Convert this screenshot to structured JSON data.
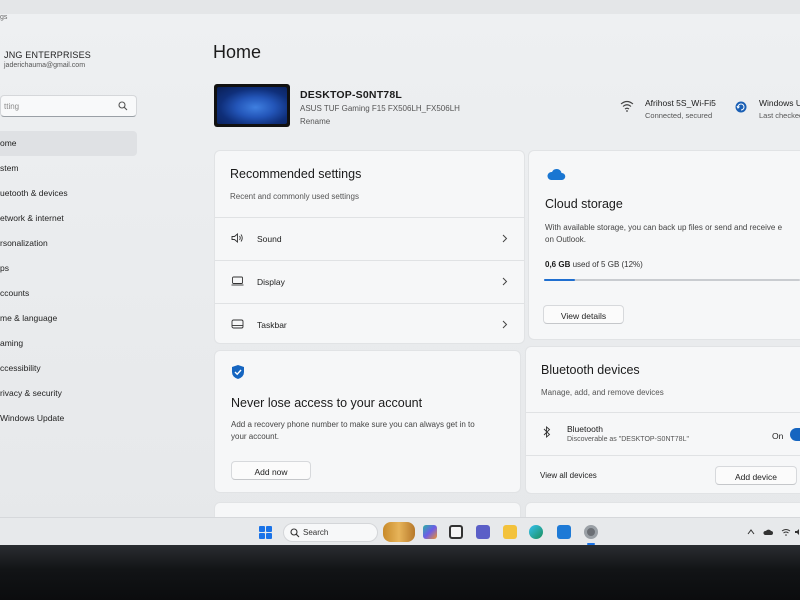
{
  "app": {
    "title": "gs"
  },
  "account": {
    "name": "JNG ENTERPRISES",
    "email": "jaderichauma@gmail.com"
  },
  "sidebar": {
    "search_placeholder": "tting",
    "items": [
      {
        "label": "ome"
      },
      {
        "label": "stem"
      },
      {
        "label": "uetooth & devices"
      },
      {
        "label": "etwork & internet"
      },
      {
        "label": "rsonalization"
      },
      {
        "label": "ps"
      },
      {
        "label": "ccounts"
      },
      {
        "label": "me & language"
      },
      {
        "label": "aming"
      },
      {
        "label": "ccessibility"
      },
      {
        "label": "rivacy & security"
      },
      {
        "label": "Windows Update"
      }
    ]
  },
  "main": {
    "title": "Home"
  },
  "device": {
    "name": "DESKTOP-S0NT78L",
    "model": "ASUS TUF Gaming F15 FX506LH_FX506LH",
    "rename": "Rename"
  },
  "network": {
    "name": "Afrihost 5S_Wi-Fi5",
    "status": "Connected, secured"
  },
  "update": {
    "name": "Windows U",
    "status": "Last checked"
  },
  "recommended": {
    "title": "Recommended settings",
    "subtitle": "Recent and commonly used settings",
    "items": [
      {
        "label": "Sound",
        "icon": "speaker-icon"
      },
      {
        "label": "Display",
        "icon": "monitor-icon"
      },
      {
        "label": "Taskbar",
        "icon": "taskbar-icon"
      }
    ]
  },
  "cloud": {
    "title": "Cloud storage",
    "description_line1": "With available storage, you can back up files or send and receive e",
    "description_line2": "on Outlook.",
    "usage_bold": "0,6 GB",
    "usage_rest": "used of 5 GB (12%)",
    "usage_fraction": 0.12,
    "button": "View details"
  },
  "account_card": {
    "title": "Never lose access to your account",
    "description_line1": "Add a recovery phone number to make sure you can always get in to",
    "description_line2": "your account.",
    "button": "Add now"
  },
  "bluetooth": {
    "title": "Bluetooth devices",
    "subtitle": "Manage, add, and remove devices",
    "device_label": "Bluetooth",
    "device_status": "Discoverable as \"DESKTOP-S0NT78L\"",
    "toggle_label": "On",
    "view_all": "View all devices",
    "add_device": "Add device"
  },
  "taskbar": {
    "search_label": "Search"
  },
  "colors": {
    "accent": "#1565c0",
    "progress": "#1f6fd0"
  }
}
